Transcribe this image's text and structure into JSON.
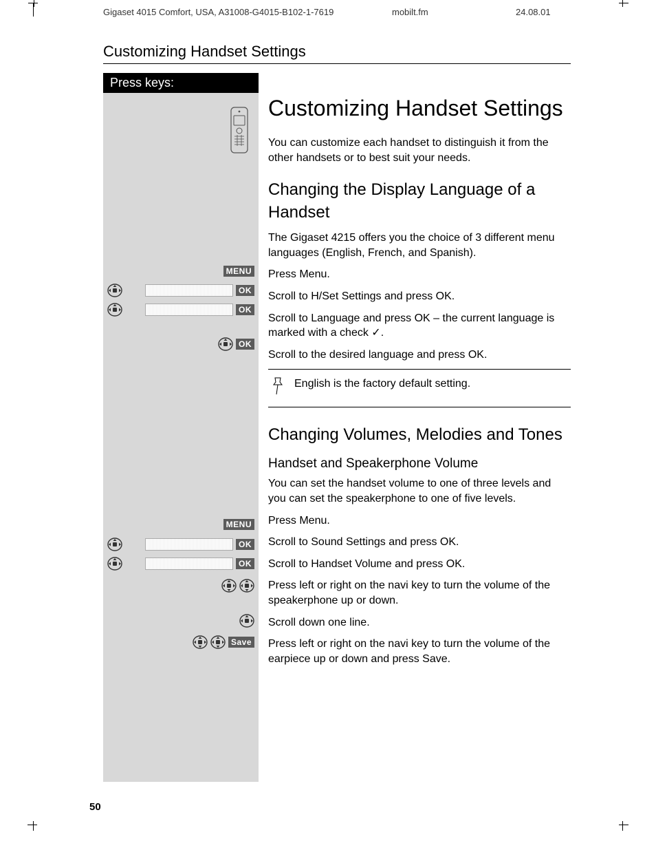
{
  "header": {
    "doc_id": "Gigaset 4015 Comfort, USA, A31008-G4015-B102-1-7619",
    "filename": "mobilt.fm",
    "date": "24.08.01"
  },
  "section_title": "Customizing Handset Settings",
  "sidebar": {
    "header": "Press keys:",
    "labels": {
      "menu": "MENU",
      "ok": "OK",
      "save": "Save"
    }
  },
  "main": {
    "h1": "Customizing Handset Settings",
    "intro": "You can customize each handset to distinguish it from the other handsets or to best suit your needs.",
    "h2_lang": "Changing the Display Language of a Handset",
    "lang_intro": "The Gigaset 4215 offers you the choice of 3 different menu languages (English, French, and Spanish).",
    "lang_steps": [
      "Press Menu.",
      "Scroll to H/Set Settings and press OK.",
      "Scroll to Language and press OK – the current language is marked with a check ✓.",
      "Scroll to the desired language and press OK."
    ],
    "lang_note": "English is the factory default setting.",
    "h2_vol": "Changing Volumes, Melodies and Tones",
    "h3_vol": "Handset and Speakerphone Volume",
    "vol_intro": "You can set the handset volume to one of three levels and you can set the speakerphone to one of five levels.",
    "vol_steps": [
      "Press Menu.",
      "Scroll to Sound Settings and press OK.",
      "Scroll to Handset Volume and press OK.",
      "Press left or right on the navi key to turn the volume of the speakerphone up or down.",
      "Scroll down one line.",
      "Press left or right on the navi key to turn the volume of the earpiece up or down and press Save."
    ]
  },
  "page_number": "50"
}
